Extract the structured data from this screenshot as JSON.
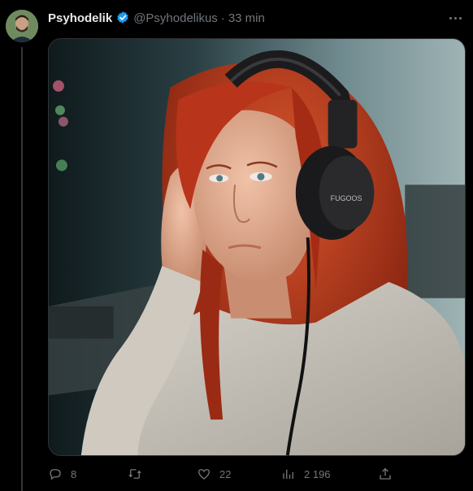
{
  "author": {
    "display_name": "Psyhodelik",
    "handle": "@Psyhodelikus",
    "separator": "·",
    "timestamp": "33 min",
    "verified": true,
    "avatar_icon": "avatar-photo"
  },
  "media": {
    "headphone_brand": "FUGOOS"
  },
  "actions": {
    "reply_count": "8",
    "retweet_count": "",
    "like_count": "22",
    "views_count": "2 196"
  },
  "colors": {
    "background": "#000000",
    "text_primary": "#e7e9ea",
    "text_secondary": "#71767b",
    "verified_blue": "#1d9bf0",
    "hair": "#b8341a"
  }
}
